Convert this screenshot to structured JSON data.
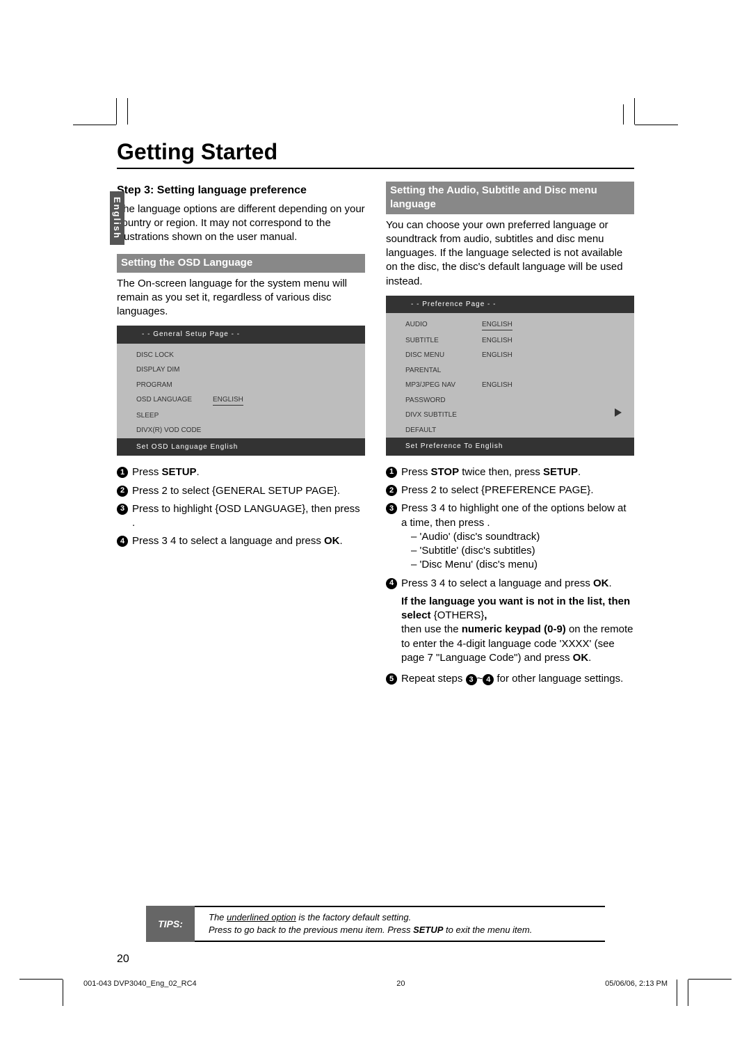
{
  "title": "Getting Started",
  "sideTab": "English",
  "step3": {
    "heading": "Step 3:  Setting language preference",
    "para": "The language options are different depending on your country or region. It may not correspond to the illustrations shown on the user manual."
  },
  "osd": {
    "heading": "Setting the OSD Language",
    "para": "The On-screen language for the system menu will remain as you set it, regardless of various disc languages.",
    "menu": {
      "header": "- -  General Setup Page  - -",
      "rows": [
        [
          "DISC LOCK",
          ""
        ],
        [
          "DISPLAY DIM",
          ""
        ],
        [
          "PROGRAM",
          ""
        ],
        [
          "OSD LANGUAGE",
          "ENGLISH"
        ],
        [
          "SLEEP",
          ""
        ],
        [
          "DIVX(R) VOD CODE",
          ""
        ]
      ],
      "footer": "Set OSD Language English"
    },
    "steps": {
      "s1": "Press ",
      "s1b": "SETUP",
      "s1c": ".",
      "s2": "Press 2  to select {GENERAL SETUP PAGE}.",
      "s3a": "Press ",
      "s3b": " to highlight {OSD LANGUAGE}, then press ",
      "s3c": ".",
      "s4a": "Press 3  4  to select a language and press ",
      "s4b": "OK",
      "s4c": "."
    }
  },
  "asd": {
    "heading": "Setting the Audio, Subtitle and Disc menu language",
    "para": "You can choose your own preferred language or soundtrack from audio, subtitles and disc menu languages. If the language selected is not available on the disc, the disc's default language will be used instead.",
    "menu": {
      "header": "- -  Preference Page  - -",
      "rows": [
        [
          "AUDIO",
          "ENGLISH"
        ],
        [
          "SUBTITLE",
          "ENGLISH"
        ],
        [
          "DISC MENU",
          "ENGLISH"
        ],
        [
          "PARENTAL",
          ""
        ],
        [
          "MP3/JPEG NAV",
          "ENGLISH"
        ],
        [
          "PASSWORD",
          ""
        ],
        [
          "DIVX SUBTITLE",
          ""
        ],
        [
          "DEFAULT",
          ""
        ]
      ],
      "footer": "Set Preference To English",
      "arrowRight": true
    },
    "steps": {
      "s1a": "Press ",
      "s1b": "STOP",
      "s1c": " twice then, press ",
      "s1d": "SETUP",
      "s1e": ".",
      "s2": "Press 2  to select {PREFERENCE PAGE}.",
      "s3a": "Press 3  4  to highlight one of the options below at a time, then press ",
      "s3b": ".",
      "s3list": [
        "–   'Audio' (disc's soundtrack)",
        "–   'Subtitle' (disc's subtitles)",
        "–   'Disc Menu' (disc's menu)"
      ],
      "s4a": "Press 3  4  to select a language and press ",
      "s4b": "OK",
      "s4c": ".",
      "note1b": "If the language you want is not in the list, then select ",
      "note1c": "{OTHERS}",
      "note1d": ",",
      "note2a": "then use the ",
      "note2b": "numeric keypad (0-9)",
      "note2c": " on the remote to enter the 4-digit language code 'XXXX' (see page 7 \"Language Code\") and press ",
      "note2d": "OK",
      "note2e": ".",
      "s5a": "Repeat steps ",
      "s5b": "~",
      "s5c": " for other language settings."
    }
  },
  "tips": {
    "label": "TIPS:",
    "l1a": "The ",
    "l1b": "underlined option",
    "l1c": " is the factory default setting.",
    "l2a": "Press ",
    "l2b": " to go back to the previous menu item. Press ",
    "l2c": "SETUP",
    "l2d": " to exit the menu item."
  },
  "pageNum": "20",
  "footer": {
    "left": "001-043 DVP3040_Eng_02_RC4",
    "mid": "20",
    "right": "05/06/06, 2:13 PM"
  }
}
